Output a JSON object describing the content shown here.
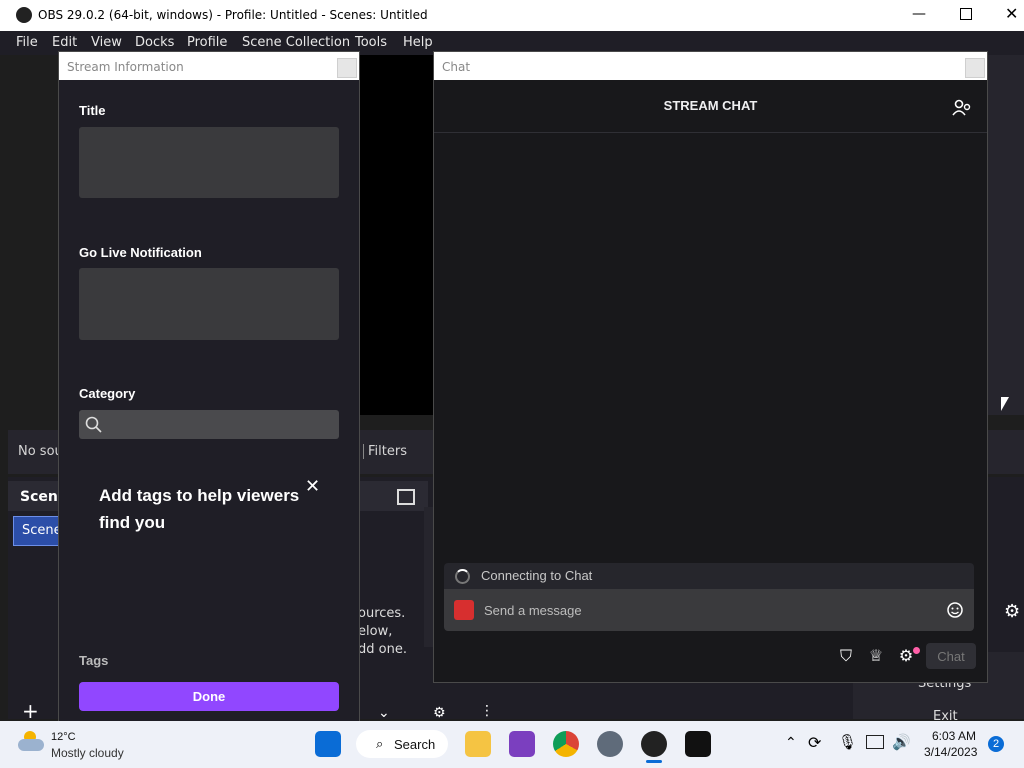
{
  "window": {
    "title": "OBS 29.0.2 (64-bit, windows) - Profile: Untitled - Scenes: Untitled"
  },
  "menu": [
    "File",
    "Edit",
    "View",
    "Docks",
    "Profile",
    "Scene Collection",
    "Tools",
    "Help"
  ],
  "background": {
    "no_source": "No sou",
    "filters": "Filters",
    "scenes": "Scene",
    "scene_item": "Scene",
    "hint_lines": [
      "ources.",
      "elow,",
      "dd one."
    ],
    "settings": "Settings",
    "exit": "Exit"
  },
  "stream_info": {
    "dock_title": "Stream Information",
    "title_label": "Title",
    "notification_label": "Go Live Notification",
    "category_label": "Category",
    "tags_prompt": "Add tags to help viewers find you",
    "tags_label": "Tags",
    "done_label": "Done"
  },
  "chat": {
    "dock_title": "Chat",
    "header": "STREAM CHAT",
    "connecting": "Connecting to Chat",
    "placeholder": "Send a message",
    "chat_button": "Chat"
  },
  "taskbar": {
    "weather_temp": "12°C",
    "weather_desc": "Mostly cloudy",
    "search_label": "Search",
    "time": "6:03 AM",
    "date": "3/14/2023",
    "notifications": "2"
  }
}
